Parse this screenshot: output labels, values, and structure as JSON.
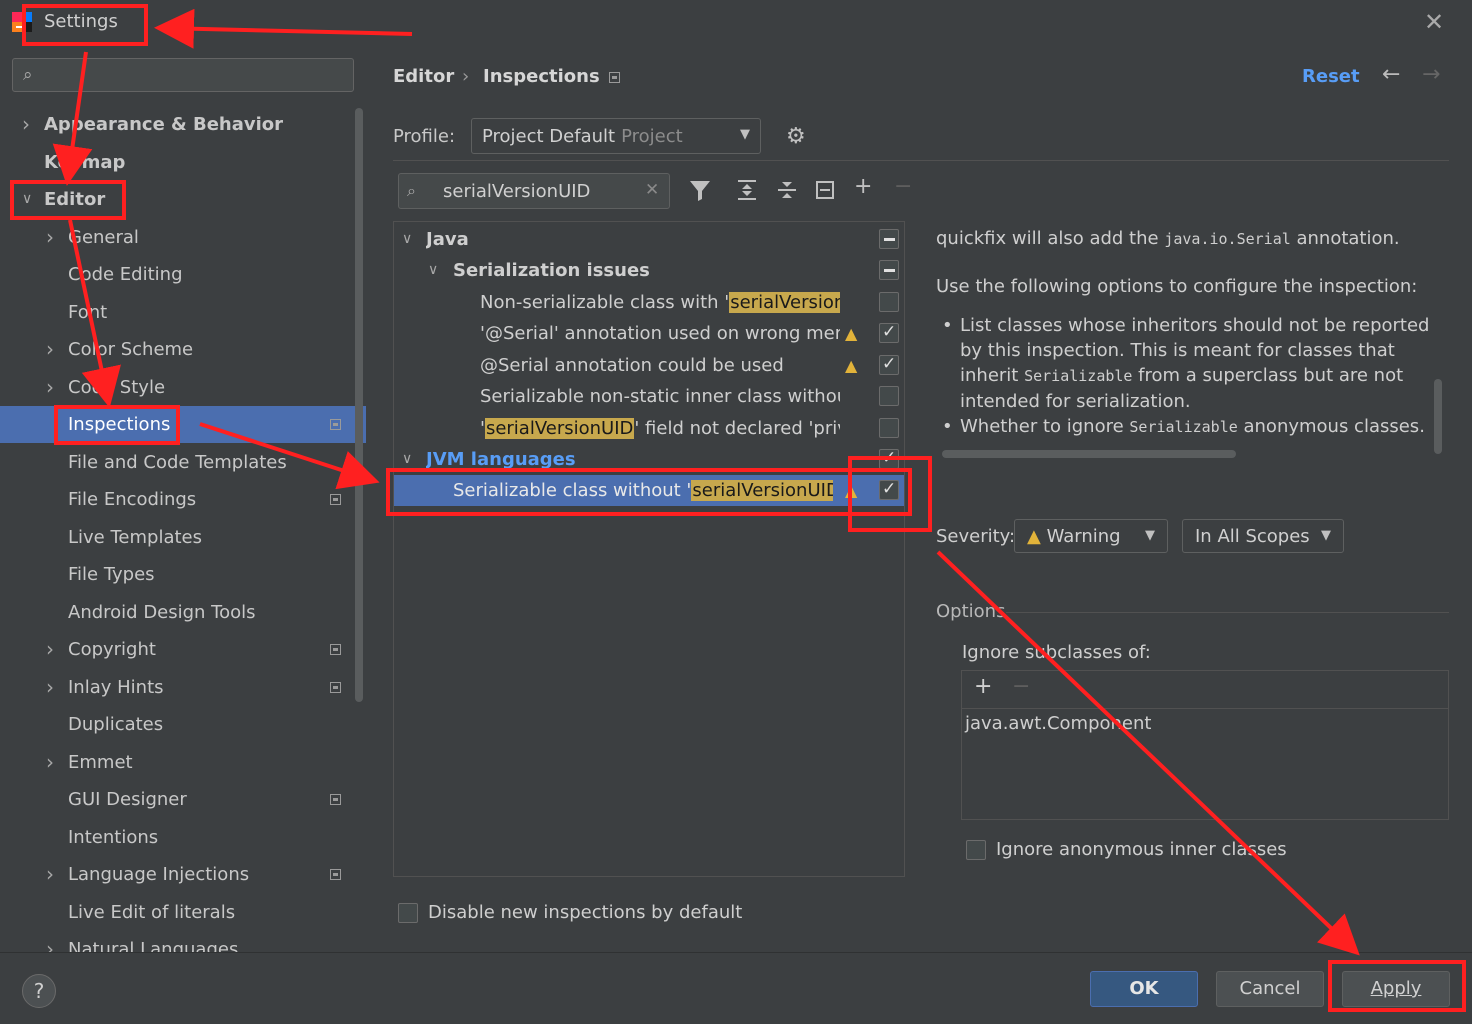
{
  "window": {
    "title": "Settings"
  },
  "sidebar": {
    "search_placeholder": "",
    "items": [
      {
        "label": "Appearance & Behavior",
        "arrow": ">"
      },
      {
        "label": "Keymap",
        "arrow": ""
      },
      {
        "label": "Editor",
        "arrow": "v"
      },
      {
        "label": "General",
        "arrow": ">"
      },
      {
        "label": "Code Editing",
        "arrow": ""
      },
      {
        "label": "Font",
        "arrow": ""
      },
      {
        "label": "Color Scheme",
        "arrow": ">"
      },
      {
        "label": "Code Style",
        "arrow": ">"
      },
      {
        "label": "Inspections",
        "arrow": ""
      },
      {
        "label": "File and Code Templates",
        "arrow": ""
      },
      {
        "label": "File Encodings",
        "arrow": ""
      },
      {
        "label": "Live Templates",
        "arrow": ""
      },
      {
        "label": "File Types",
        "arrow": ""
      },
      {
        "label": "Android Design Tools",
        "arrow": ""
      },
      {
        "label": "Copyright",
        "arrow": ">"
      },
      {
        "label": "Inlay Hints",
        "arrow": ">"
      },
      {
        "label": "Duplicates",
        "arrow": ""
      },
      {
        "label": "Emmet",
        "arrow": ">"
      },
      {
        "label": "GUI Designer",
        "arrow": ""
      },
      {
        "label": "Intentions",
        "arrow": ""
      },
      {
        "label": "Language Injections",
        "arrow": ">"
      },
      {
        "label": "Live Edit of literals",
        "arrow": ""
      },
      {
        "label": "Natural Languages",
        "arrow": ">"
      }
    ]
  },
  "breadcrumb": {
    "parent": "Editor",
    "separator": "›",
    "current": "Inspections"
  },
  "header": {
    "reset": "Reset"
  },
  "profile": {
    "label": "Profile:",
    "value": "Project Default",
    "scope": "Project"
  },
  "inspection_search": {
    "value": "serialVersionUID"
  },
  "tree": {
    "java": "Java",
    "serialization": "Serialization issues",
    "r1_text": "Non-serializable class with '",
    "r1_hl": "serialVersionU",
    "r2_text": "'@Serial' annotation used on wrong mem",
    "r3_text": "@Serial annotation could be used",
    "r4_text": "Serializable non-static inner class without",
    "r5_pre": "'",
    "r5_hl": "serialVersionUID",
    "r5_post": "' field not declared 'priva",
    "jvm": "JVM languages",
    "r6_pre": "Serializable class without '",
    "r6_hl": "serialVersionUID",
    "r6_post": "'"
  },
  "description": {
    "line0_pre": "quickfix will also add the ",
    "line0_code": "java.io.Serial",
    "line0_post": " annotation.",
    "intro": "Use the following options to configure the inspection:",
    "b1_a": "List classes whose inheritors should not be reported by this inspection. This is meant for classes that inherit ",
    "b1_code": "Serializable",
    "b1_b": " from a superclass but are not intended for serialization.",
    "b2_a": "Whether to ignore ",
    "b2_code": "Serializable",
    "b2_b": " anonymous classes."
  },
  "severity": {
    "label": "Severity:",
    "value": "Warning",
    "scope": "In All Scopes"
  },
  "options": {
    "title": "Options",
    "ignore_subclasses_label": "Ignore subclasses of:",
    "list_items": [
      "java.awt.Component"
    ],
    "ignore_anon_label": "Ignore anonymous inner classes"
  },
  "disable_new": "Disable new inspections by default",
  "footer": {
    "help": "?",
    "ok": "OK",
    "cancel": "Cancel",
    "apply": "Apply"
  },
  "colors": {
    "accent": "#4b6eaf",
    "link": "#589df6",
    "highlight": "#c7a84d",
    "annotation": "#ff2020",
    "warning": "#e2b33a"
  }
}
